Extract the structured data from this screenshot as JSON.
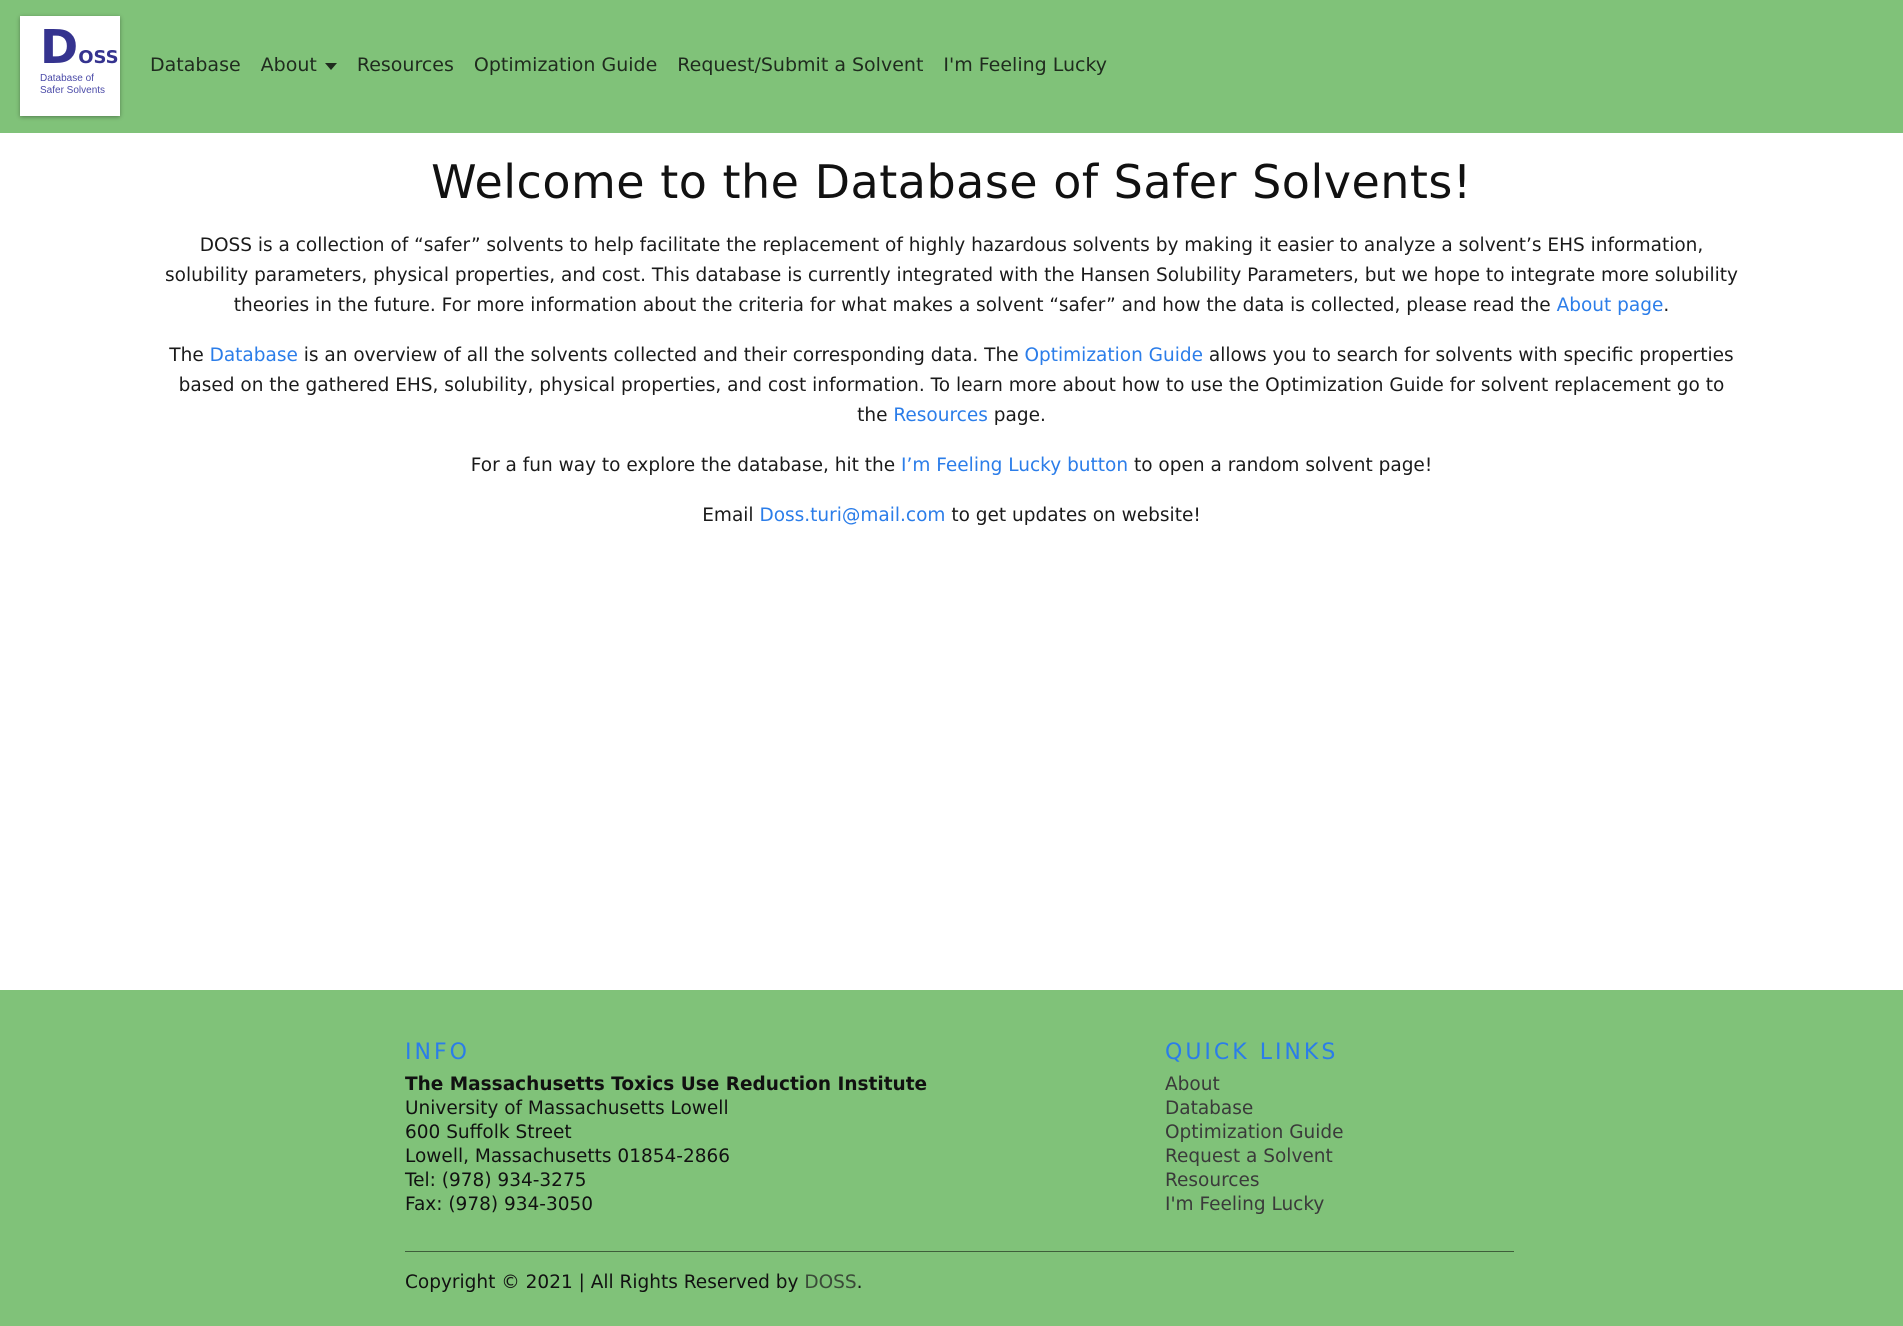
{
  "brand": {
    "logo_mark_big": "D",
    "logo_mark_small": "OSS",
    "logo_sub_line1": "Database of",
    "logo_sub_line2": "Safer Solvents"
  },
  "nav": {
    "items": [
      {
        "label": "Database"
      },
      {
        "label": "About",
        "has_dropdown": true
      },
      {
        "label": "Resources"
      },
      {
        "label": "Optimization Guide"
      },
      {
        "label": "Request/Submit a Solvent"
      },
      {
        "label": "I'm Feeling Lucky"
      }
    ]
  },
  "main": {
    "title": "Welcome to the Database of Safer Solvents!",
    "p1": {
      "text": "DOSS is a collection of “safer” solvents to help facilitate the replacement of highly hazardous solvents by making it easier to analyze a solvent’s EHS information, solubility parameters, physical properties, and cost. This database is currently integrated with the Hansen Solubility Parameters, but we hope to integrate more solubility theories in the future. For more information about the criteria for what makes a solvent “safer” and how the data is collected, please read the ",
      "link": "About page",
      "after": "."
    },
    "p2": {
      "t1": "The ",
      "link1": "Database",
      "t2": " is an overview of all the solvents collected and their corresponding data. The ",
      "link2": "Optimization Guide",
      "t3": " allows you to search for solvents with specific properties based on the gathered EHS, solubility, physical properties, and cost information. To learn more about how to use the Optimization Guide for solvent replacement go to the ",
      "link3": "Resources",
      "t4": " page."
    },
    "p3": {
      "t1": "For a fun way to explore the database, hit the ",
      "link": "I’m Feeling Lucky button",
      "t2": " to open a random solvent page!"
    },
    "p4": {
      "t1": "Email ",
      "link": "Doss.turi@mail.com",
      "t2": " to get updates on website!"
    }
  },
  "footer": {
    "info": {
      "heading": "INFO",
      "org": "The Massachusetts Toxics Use Reduction Institute",
      "lines": [
        "University of Massachusetts Lowell",
        "600 Suffolk Street",
        "Lowell, Massachusetts 01854-2866",
        "Tel: (978) 934-3275",
        "Fax: (978) 934-3050"
      ]
    },
    "quick_links": {
      "heading": "QUICK LINKS",
      "items": [
        "About",
        "Database",
        "Optimization Guide",
        "Request a Solvent",
        "Resources",
        "I'm Feeling Lucky"
      ]
    },
    "copyright": {
      "text": "Copyright © 2021 | All Rights Reserved by ",
      "link": "DOSS",
      "after": "."
    }
  },
  "colors": {
    "header_bg": "#80c279",
    "link": "#2b7de9",
    "logo": "#35338f"
  }
}
